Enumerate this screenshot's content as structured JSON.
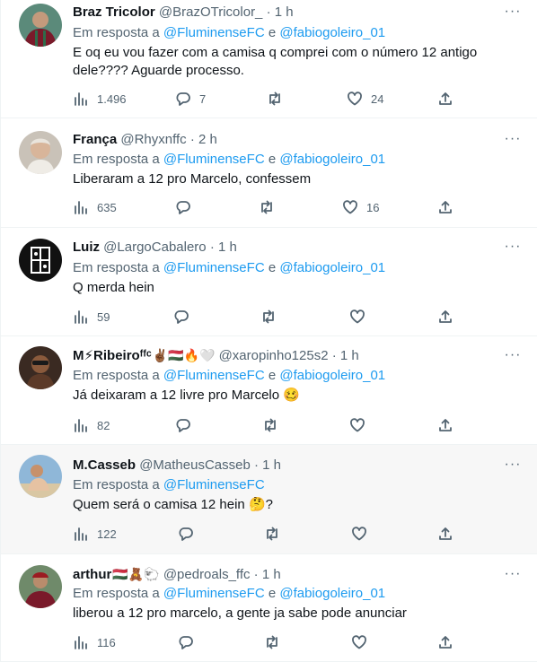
{
  "reply_prefix": "Em resposta a",
  "reply_joiner": "e",
  "more_label": "···",
  "tweets": [
    {
      "name": "Braz Tricolor",
      "name_emoji": "",
      "handle": "@BrazOTricolor_",
      "time": "1 h",
      "mentions": [
        "@FluminenseFC",
        "@fabiogoleiro_01"
      ],
      "lines": [
        "E oq eu vou fazer com a camisa q comprei com o número 12 antigo",
        "dele???? Aguarde processo."
      ],
      "inline_emoji": "",
      "views": "1.496",
      "replies": "7",
      "retweets": "",
      "likes": "24"
    },
    {
      "name": "França",
      "name_emoji": "",
      "handle": "@Rhyxnffc",
      "time": "2 h",
      "mentions": [
        "@FluminenseFC",
        "@fabiogoleiro_01"
      ],
      "lines": [
        "Liberaram a 12 pro Marcelo, confessem"
      ],
      "inline_emoji": "",
      "views": "635",
      "replies": "",
      "retweets": "",
      "likes": "16"
    },
    {
      "name": "Luiz",
      "name_emoji": "",
      "handle": "@LargoCabalero",
      "time": "1 h",
      "mentions": [
        "@FluminenseFC",
        "@fabiogoleiro_01"
      ],
      "lines": [
        "Q merda hein"
      ],
      "inline_emoji": "",
      "views": "59",
      "replies": "",
      "retweets": "",
      "likes": ""
    },
    {
      "name": "M⚡Ribeiroᶠᶠᶜ",
      "name_emoji": "✌🏾🇭🇺🔥🤍",
      "handle": "@xaropinho125s2",
      "time": "1 h",
      "mentions": [
        "@FluminenseFC",
        "@fabiogoleiro_01"
      ],
      "lines": [
        "Já deixaram a 12 livre pro Marcelo"
      ],
      "inline_emoji": "🥴",
      "views": "82",
      "replies": "",
      "retweets": "",
      "likes": ""
    },
    {
      "name": "M.Casseb",
      "name_emoji": "",
      "handle": "@MatheusCasseb",
      "time": "1 h",
      "mentions": [
        "@FluminenseFC"
      ],
      "lines": [
        "Quem será o camisa 12 hein"
      ],
      "inline_emoji": "🤔",
      "text_suffix": "?",
      "views": "122",
      "replies": "",
      "retweets": "",
      "likes": ""
    },
    {
      "name": "arthur",
      "name_emoji": "🇭🇺🧸🐑",
      "handle": "@pedroals_ffc",
      "time": "1 h",
      "mentions": [
        "@FluminenseFC",
        "@fabiogoleiro_01"
      ],
      "lines": [
        "liberou a 12 pro marcelo, a gente ja sabe pode anunciar"
      ],
      "inline_emoji": "",
      "views": "116",
      "replies": "",
      "retweets": "",
      "likes": ""
    }
  ],
  "colors": {
    "link": "#1d9bf0",
    "muted": "#536471",
    "text": "#0f1419",
    "highlight_bg": "#f7f7f7"
  },
  "icons": [
    "views-icon",
    "reply-icon",
    "retweet-icon",
    "like-icon",
    "share-icon",
    "more-icon"
  ]
}
